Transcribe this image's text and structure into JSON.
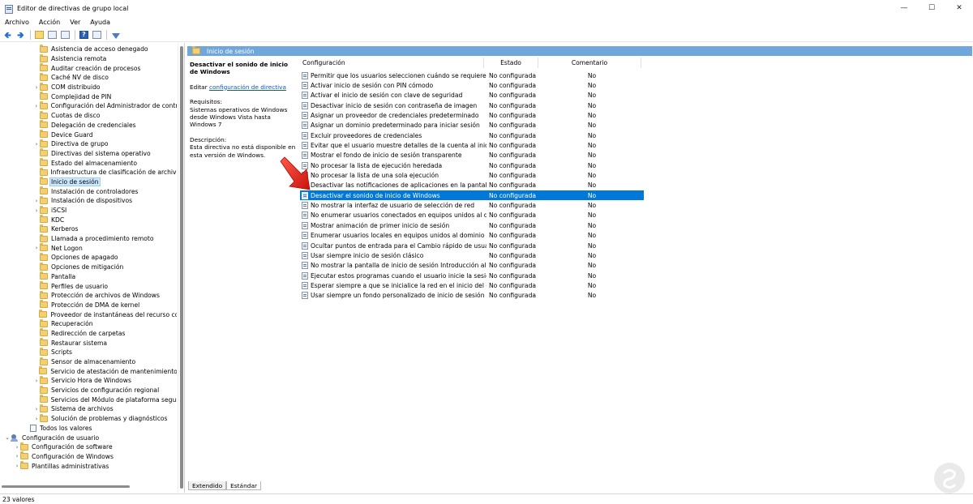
{
  "window": {
    "title": "Editor de directivas de grupo local"
  },
  "menu": [
    "Archivo",
    "Acción",
    "Ver",
    "Ayuda"
  ],
  "toolbar": [
    "back-icon",
    "forward-icon",
    "up-folder-icon",
    "show-hide-tree-icon",
    "export-icon",
    "help-icon",
    "properties-icon",
    "filter-icon"
  ],
  "tree": [
    {
      "label": "Asistencia de acceso denegado",
      "level": 3,
      "expand": false
    },
    {
      "label": "Asistencia remota",
      "level": 3,
      "expand": false
    },
    {
      "label": "Auditar creación de procesos",
      "level": 3,
      "expand": false
    },
    {
      "label": "Caché NV de disco",
      "level": 3,
      "expand": false
    },
    {
      "label": "COM distribuido",
      "level": 3,
      "expand": true
    },
    {
      "label": "Complejidad de PIN",
      "level": 3,
      "expand": false
    },
    {
      "label": "Configuración del Administrador de contro",
      "level": 3,
      "expand": true
    },
    {
      "label": "Cuotas de disco",
      "level": 3,
      "expand": false
    },
    {
      "label": "Delegación de credenciales",
      "level": 3,
      "expand": false
    },
    {
      "label": "Device Guard",
      "level": 3,
      "expand": false
    },
    {
      "label": "Directiva de grupo",
      "level": 3,
      "expand": true
    },
    {
      "label": "Directivas del sistema operativo",
      "level": 3,
      "expand": false
    },
    {
      "label": "Estado del almacenamiento",
      "level": 3,
      "expand": false
    },
    {
      "label": "Infraestructura de clasificación de archivos",
      "level": 3,
      "expand": false
    },
    {
      "label": "Inicio de sesión",
      "level": 3,
      "expand": false,
      "selected": true
    },
    {
      "label": "Instalación de controladores",
      "level": 3,
      "expand": false
    },
    {
      "label": "Instalación de dispositivos",
      "level": 3,
      "expand": true
    },
    {
      "label": "iSCSI",
      "level": 3,
      "expand": true
    },
    {
      "label": "KDC",
      "level": 3,
      "expand": false
    },
    {
      "label": "Kerberos",
      "level": 3,
      "expand": false
    },
    {
      "label": "Llamada a procedimiento remoto",
      "level": 3,
      "expand": false
    },
    {
      "label": "Net Logon",
      "level": 3,
      "expand": true
    },
    {
      "label": "Opciones de apagado",
      "level": 3,
      "expand": false
    },
    {
      "label": "Opciones de mitigación",
      "level": 3,
      "expand": false
    },
    {
      "label": "Pantalla",
      "level": 3,
      "expand": false
    },
    {
      "label": "Perfiles de usuario",
      "level": 3,
      "expand": false
    },
    {
      "label": "Protección de archivos de Windows",
      "level": 3,
      "expand": false
    },
    {
      "label": "Protección de DMA de kernel",
      "level": 3,
      "expand": false
    },
    {
      "label": "Proveedor de instantáneas del recurso com",
      "level": 3,
      "expand": false
    },
    {
      "label": "Recuperación",
      "level": 3,
      "expand": false
    },
    {
      "label": "Redirección de carpetas",
      "level": 3,
      "expand": false
    },
    {
      "label": "Restaurar sistema",
      "level": 3,
      "expand": false
    },
    {
      "label": "Scripts",
      "level": 3,
      "expand": false
    },
    {
      "label": "Sensor de almacenamiento",
      "level": 3,
      "expand": false
    },
    {
      "label": "Servicio de atestación de mantenimiento de",
      "level": 3,
      "expand": false
    },
    {
      "label": "Servicio Hora de Windows",
      "level": 3,
      "expand": true
    },
    {
      "label": "Servicios de configuración regional",
      "level": 3,
      "expand": false
    },
    {
      "label": "Servicios del Módulo de plataforma segura",
      "level": 3,
      "expand": false
    },
    {
      "label": "Sistema de archivos",
      "level": 3,
      "expand": true
    },
    {
      "label": "Solución de problemas y diagnósticos",
      "level": 3,
      "expand": true
    },
    {
      "label": "Todos los valores",
      "level": 2,
      "expand": false,
      "icon": "doc"
    },
    {
      "label": "Configuración de usuario",
      "level": 0,
      "expand": "open",
      "icon": "user"
    },
    {
      "label": "Configuración de software",
      "level": 1,
      "expand": true
    },
    {
      "label": "Configuración de Windows",
      "level": 1,
      "expand": true
    },
    {
      "label": "Plantillas administrativas",
      "level": 1,
      "expand": true
    }
  ],
  "section": {
    "title": "Inicio de sesión"
  },
  "description": {
    "title": "Desactivar el sonido de inicio de Windows",
    "edit_prefix": "Editar",
    "edit_link": "configuración de directiva",
    "req_label": "Requisitos:",
    "req_text": "Sistemas operativos de Windows desde Windows Vista hasta Windows 7",
    "desc_label": "Descripción:",
    "desc_text": "Esta directiva no está disponible en esta versión de Windows."
  },
  "columns": {
    "name": "Configuración",
    "state": "Estado",
    "comment": "Comentario"
  },
  "policies": [
    {
      "name": "Permitir que los usuarios seleccionen cuándo se requiere un...",
      "state": "No configurada",
      "comment": "No"
    },
    {
      "name": "Activar inicio de sesión con PIN cómodo",
      "state": "No configurada",
      "comment": "No"
    },
    {
      "name": "Activar el inicio de sesión con clave de seguridad",
      "state": "No configurada",
      "comment": "No"
    },
    {
      "name": "Desactivar inicio de sesión con contraseña de imagen",
      "state": "No configurada",
      "comment": "No"
    },
    {
      "name": "Asignar un proveedor de credenciales predeterminado",
      "state": "No configurada",
      "comment": "No"
    },
    {
      "name": "Asignar un dominio predeterminado para iniciar sesión",
      "state": "No configurada",
      "comment": "No"
    },
    {
      "name": "Excluir proveedores de credenciales",
      "state": "No configurada",
      "comment": "No"
    },
    {
      "name": "Evitar que el usuario muestre detalles de la cuenta al iniciar s...",
      "state": "No configurada",
      "comment": "No"
    },
    {
      "name": "Mostrar el fondo de inicio de sesión transparente",
      "state": "No configurada",
      "comment": "No"
    },
    {
      "name": "No procesar la lista de ejecución heredada",
      "state": "No configurada",
      "comment": "No"
    },
    {
      "name": "No procesar la lista de una sola ejecución",
      "state": "No configurada",
      "comment": "No"
    },
    {
      "name": "Desactivar las notificaciones de aplicaciones en la pantalla d...",
      "state": "No configurada",
      "comment": "No"
    },
    {
      "name": "Desactivar el sonido de inicio de Windows",
      "state": "No configurada",
      "comment": "No",
      "selected": true
    },
    {
      "name": "No mostrar la interfaz de usuario de selección de red",
      "state": "No configurada",
      "comment": "No"
    },
    {
      "name": "No enumerar usuarios conectados en equipos unidos al dom...",
      "state": "No configurada",
      "comment": "No"
    },
    {
      "name": "Mostrar animación de primer inicio de sesión",
      "state": "No configurada",
      "comment": "No"
    },
    {
      "name": "Enumerar usuarios locales en equipos unidos al dominio",
      "state": "No configurada",
      "comment": "No"
    },
    {
      "name": "Ocultar puntos de entrada para el Cambio rápido de usuario",
      "state": "No configurada",
      "comment": "No"
    },
    {
      "name": "Usar siempre inicio de sesión clásico",
      "state": "No configurada",
      "comment": "No"
    },
    {
      "name": "No mostrar la pantalla de inicio de sesión Introducción al ini...",
      "state": "No configurada",
      "comment": "No"
    },
    {
      "name": "Ejecutar estos programas cuando el usuario inicie la sesión",
      "state": "No configurada",
      "comment": "No"
    },
    {
      "name": "Esperar siempre a que se inicialice la red en el inicio del equi...",
      "state": "No configurada",
      "comment": "No"
    },
    {
      "name": "Usar siempre un fondo personalizado de inicio de sesión",
      "state": "No configurada",
      "comment": "No"
    }
  ],
  "tabs": [
    "Extendido",
    "Estándar"
  ],
  "status": {
    "text": "23 valores"
  },
  "colors": {
    "accent": "#0078d7",
    "section_header": "#6fa7dc",
    "folder": "#f4cf72",
    "arrow": "#e8231c"
  }
}
